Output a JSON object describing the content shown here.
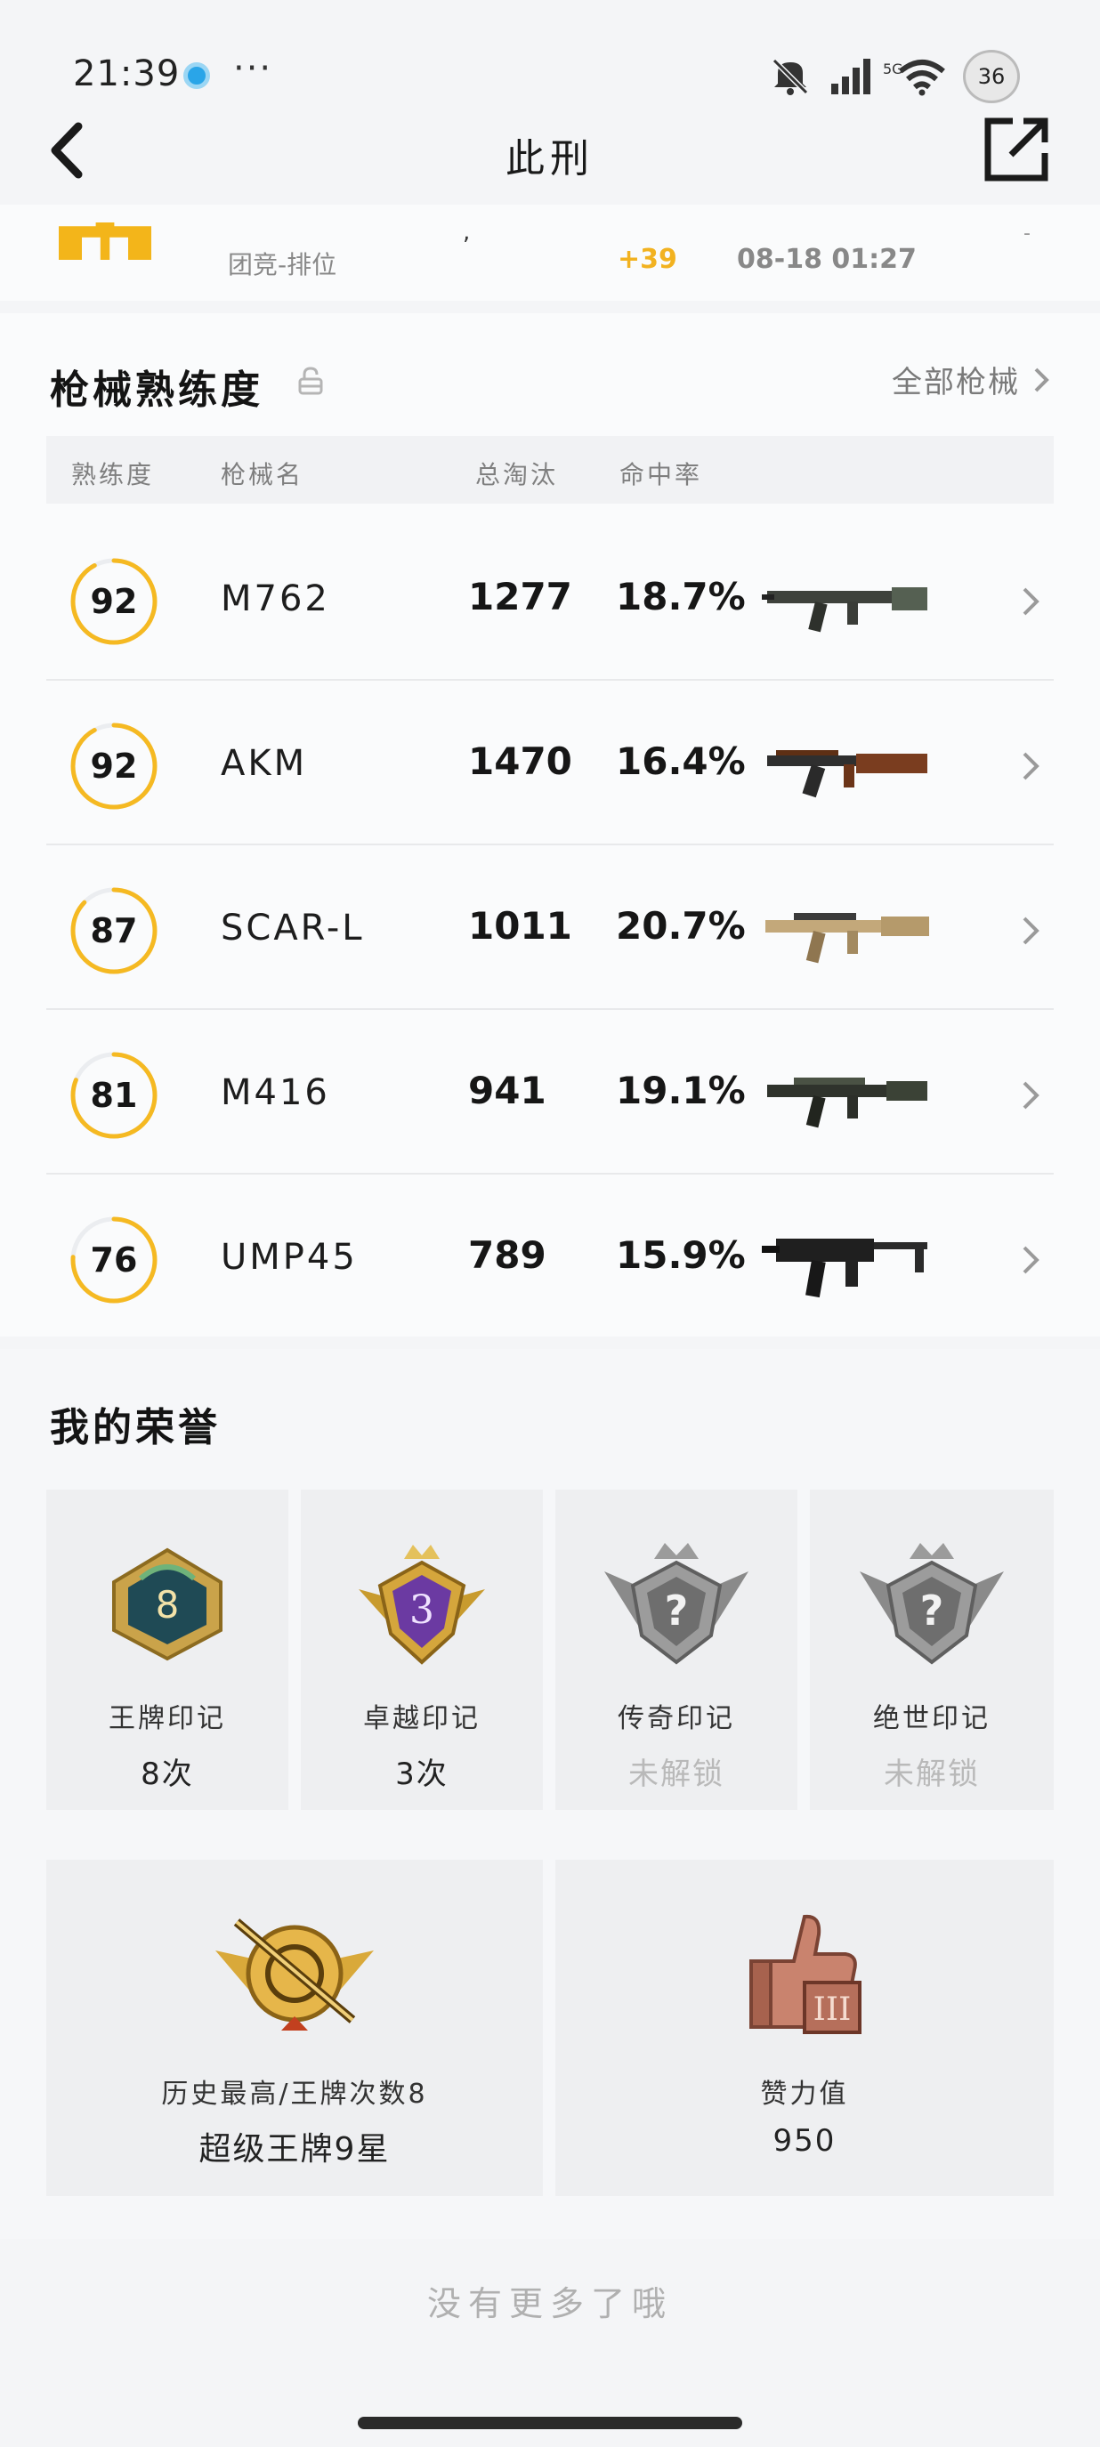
{
  "status_bar": {
    "time": "21:39",
    "dots": "···",
    "network": "5G",
    "battery": "36"
  },
  "nav": {
    "title": "此刑"
  },
  "record": {
    "mode": "团竞-排位",
    "mark": ",",
    "delta": "+39",
    "time": "08-18 01:27",
    "dot": "-"
  },
  "weapons": {
    "title": "枪械熟练度",
    "all_label": "全部枪械",
    "headers": {
      "proficiency": "熟练度",
      "name": "枪械名",
      "kills": "总淘汰",
      "hit_rate": "命中率"
    },
    "rows": [
      {
        "proficiency": 92,
        "name": "M762",
        "kills": "1277",
        "hit_rate": "18.7%",
        "icon": "m762-rifle-icon"
      },
      {
        "proficiency": 92,
        "name": "AKM",
        "kills": "1470",
        "hit_rate": "16.4%",
        "icon": "akm-rifle-icon"
      },
      {
        "proficiency": 87,
        "name": "SCAR-L",
        "kills": "1011",
        "hit_rate": "20.7%",
        "icon": "scar-l-rifle-icon"
      },
      {
        "proficiency": 81,
        "name": "M416",
        "kills": "941",
        "hit_rate": "19.1%",
        "icon": "m416-rifle-icon"
      },
      {
        "proficiency": 76,
        "name": "UMP45",
        "kills": "789",
        "hit_rate": "15.9%",
        "icon": "ump45-smg-icon"
      }
    ]
  },
  "honors": {
    "title": "我的荣誉",
    "marks": [
      {
        "label": "王牌印记",
        "value": "8次",
        "locked": false,
        "badge_text": "8",
        "icon": "ace-mark-badge-icon"
      },
      {
        "label": "卓越印记",
        "value": "3次",
        "locked": false,
        "badge_text": "3",
        "icon": "excellence-mark-badge-icon"
      },
      {
        "label": "传奇印记",
        "value": "未解锁",
        "locked": true,
        "badge_text": "?",
        "icon": "legend-mark-badge-icon"
      },
      {
        "label": "绝世印记",
        "value": "未解锁",
        "locked": true,
        "badge_text": "?",
        "icon": "peerless-mark-badge-icon"
      }
    ],
    "highest": {
      "label": "历史最高/王牌次数8",
      "value": "超级王牌9星",
      "icon": "super-ace-badge-icon"
    },
    "likes": {
      "label": "赞力值",
      "value": "950",
      "icon": "thumbs-up-badge-icon"
    }
  },
  "footer": {
    "no_more": "没有更多了哦"
  },
  "colors": {
    "accent": "#f5b922",
    "track": "#ebedf0",
    "bg": "#f4f5f7"
  }
}
